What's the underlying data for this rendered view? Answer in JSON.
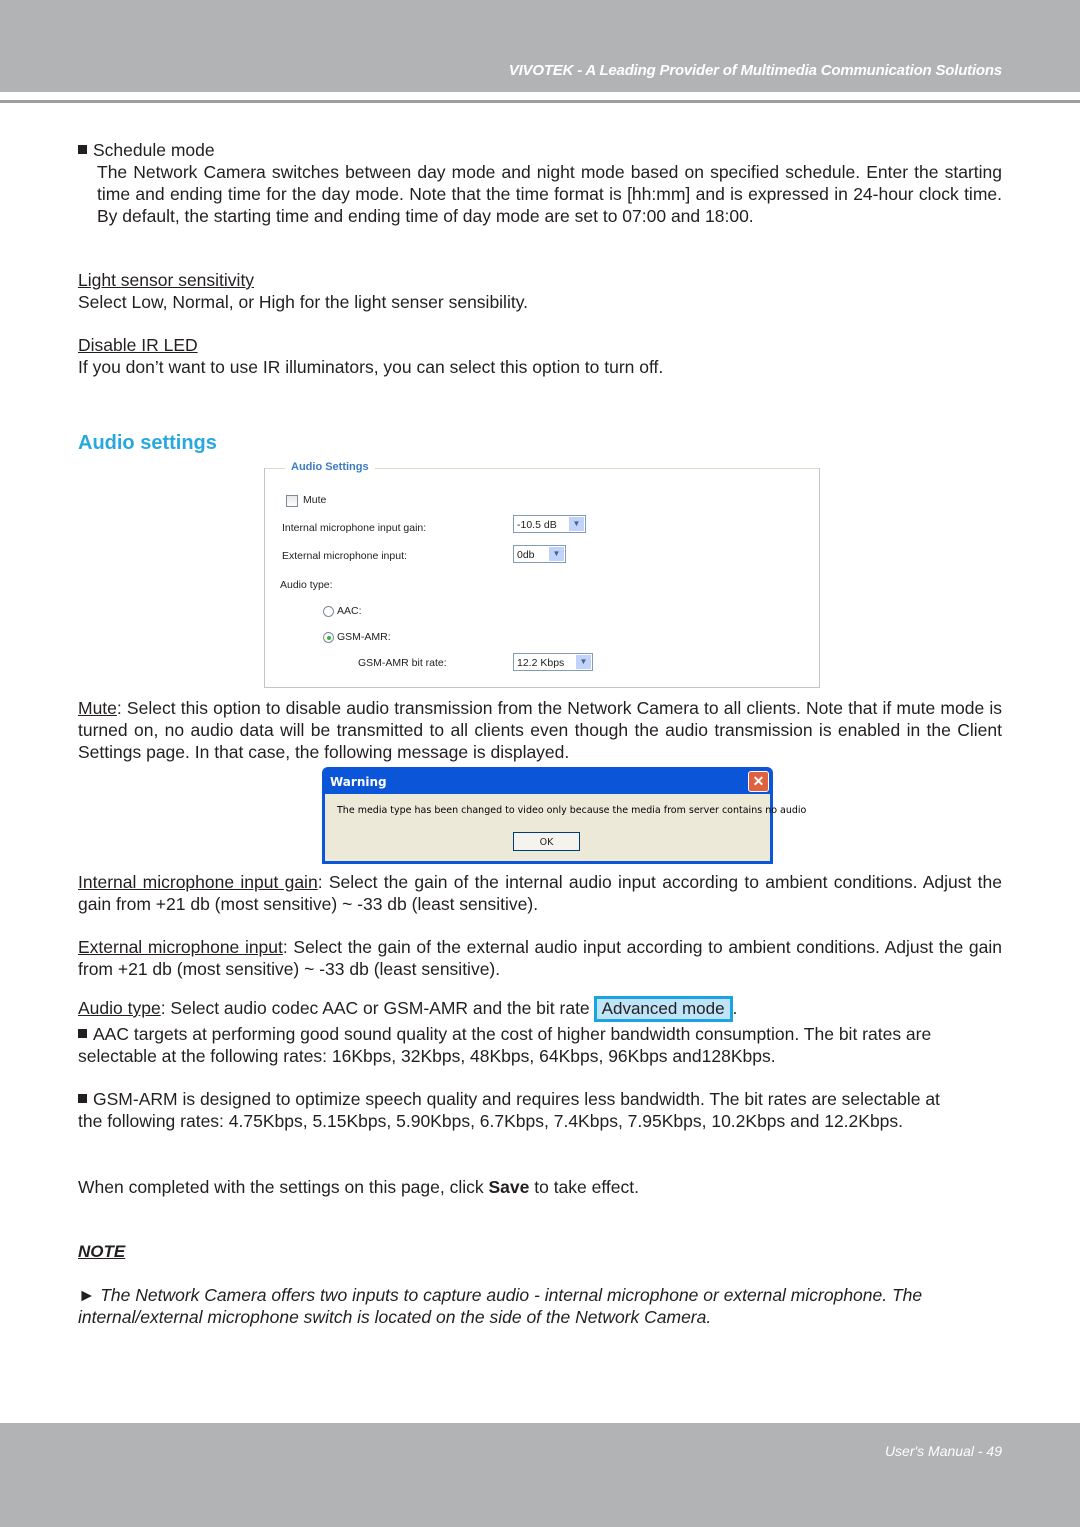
{
  "header": {
    "title": "VIVOTEK - A Leading Provider of Multimedia Communication Solutions"
  },
  "schedule_mode": {
    "heading": "Schedule mode",
    "body": "The Network Camera switches between day mode and night mode based on specified schedule. Enter the starting time and ending time for the day mode. Note that the time format is [hh:mm] and is expressed in 24-hour clock time. By default, the starting time and ending time of day mode are set to 07:00 and 18:00."
  },
  "light_sensor": {
    "heading": "Light sensor sensitivity",
    "body": "Select Low, Normal, or High for the light senser sensibility."
  },
  "disable_ir": {
    "heading": "Disable IR LED",
    "body": "If you don’t want to use IR illuminators, you can select this option to turn off."
  },
  "audio_section_title": "Audio settings",
  "audio_panel": {
    "legend": "Audio Settings",
    "mute_label": "Mute",
    "mute_checked": false,
    "internal_gain_label": "Internal microphone input gain:",
    "internal_gain_value": "-10.5 dB",
    "external_input_label": "External microphone input:",
    "external_input_value": "0db",
    "audio_type_label": "Audio type:",
    "aac_label": "AAC:",
    "gsm_label": "GSM-AMR:",
    "selected_type": "GSM-AMR",
    "gsm_bitrate_label": "GSM-AMR bit rate:",
    "gsm_bitrate_value": "12.2 Kbps"
  },
  "mute_desc": {
    "term": "Mute",
    "body": ": Select this option to disable audio transmission from the Network Camera to all clients. Note that if mute mode is turned on, no audio data will be transmitted to all clients even though the audio transmission is enabled in the Client Settings page. In that case, the following message is displayed."
  },
  "warning_dialog": {
    "title": "Warning",
    "message": "The media type has been changed to video only because the media from server contains no audio",
    "ok_label": "OK"
  },
  "internal_gain_desc": {
    "term": "Internal microphone input gain",
    "body": ": Select the gain of the internal audio input according to ambient conditions. Adjust the gain from +21 db (most sensitive) ~ -33 db (least sensitive)."
  },
  "external_input_desc": {
    "term": "External microphone input",
    "body": ": Select the gain of the external audio input according to ambient conditions. Adjust the gain from +21 db (most sensitive) ~ -33 db (least sensitive)."
  },
  "audio_type_desc": {
    "term": "Audio type",
    "body": ": Select audio codec AAC or GSM-AMR and the bit rate",
    "advanced_button": "Advanced mode",
    "after": "."
  },
  "aac_bullet": "AAC targets at performing good sound quality at the cost of higher bandwidth consumption. The bit rates are selectable at the following rates: 16Kbps, 32Kbps, 48Kbps, 64Kbps, 96Kbps and128Kbps.",
  "gsm_bullet": "GSM-ARM is designed to optimize speech quality and requires less bandwidth. The bit rates are selectable at the following rates: 4.75Kbps, 5.15Kbps, 5.90Kbps, 6.7Kbps, 7.4Kbps, 7.95Kbps, 10.2Kbps and 12.2Kbps.",
  "save_line": {
    "before": "When completed with the settings on this page, click ",
    "bold": "Save",
    "after": " to take effect."
  },
  "note": {
    "title": "NOTE",
    "marker": "►",
    "text": "The Network Camera offers two inputs to capture audio - internal microphone or external microphone. The internal/external microphone switch is located on the side of the Network Camera."
  },
  "footer": {
    "page_label": "User's Manual - 49"
  },
  "colors": {
    "header_bg": "#b2b3b5",
    "section_title": "#29a8e0",
    "advanced_button_border": "#1ba4e4",
    "advanced_button_bg": "#bfe3f7",
    "dialog_titlebar": "#0a55d8"
  }
}
